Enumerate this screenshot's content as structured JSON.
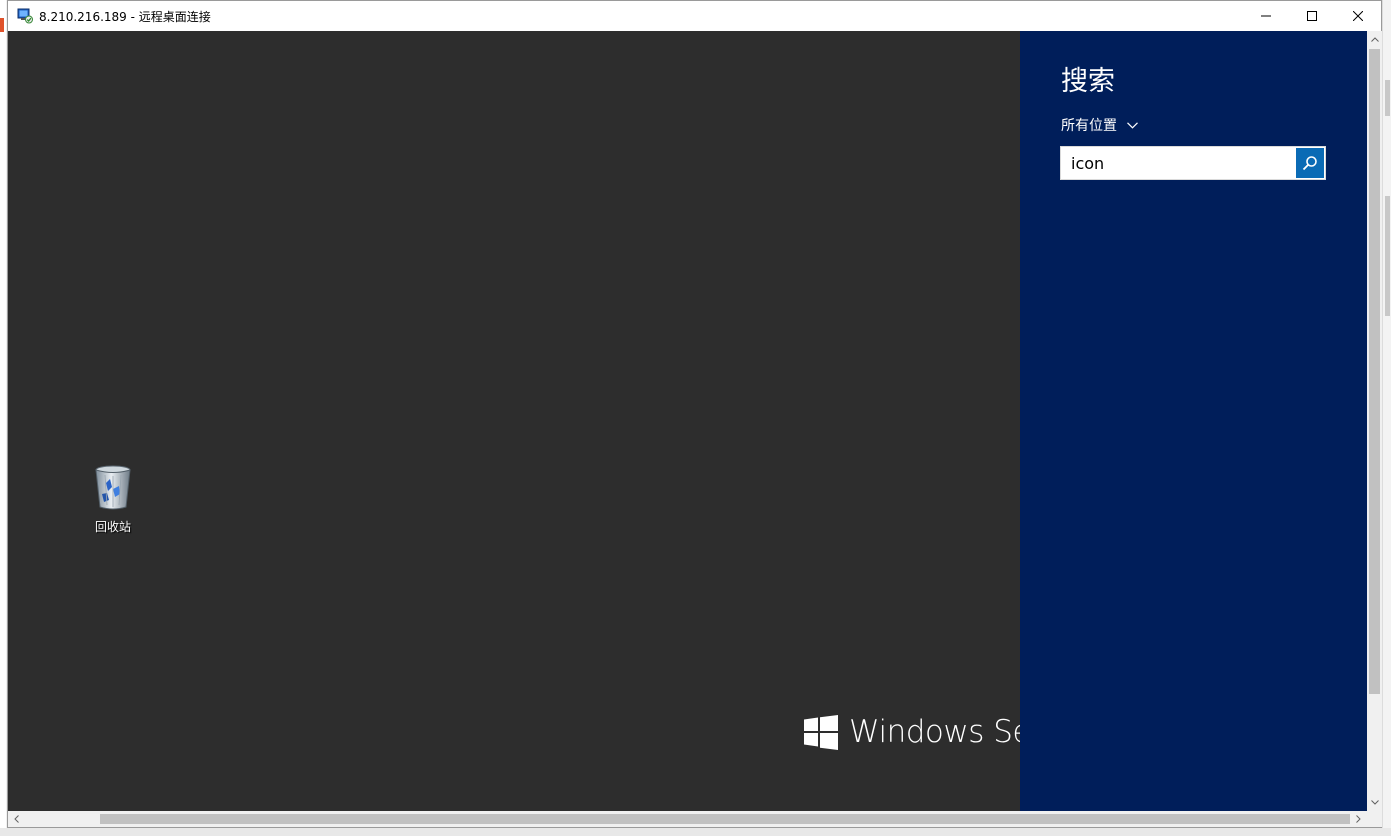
{
  "window": {
    "title": "8.210.216.189 - 远程桌面连接",
    "icon": "remote-desktop-icon",
    "controls": {
      "minimize": "minimize-icon",
      "maximize": "maximize-icon",
      "close": "close-icon"
    }
  },
  "desktop": {
    "background": "#2d2d2d",
    "icons": [
      {
        "label": "回收站",
        "icon": "recycle-bin-icon"
      }
    ],
    "brand": {
      "logo": "windows-logo-icon",
      "text": "Windows Serv"
    }
  },
  "search_charm": {
    "background": "#001e5a",
    "title": "搜索",
    "scope_label": "所有位置",
    "query": "icon",
    "button_color": "#0a6bb5"
  }
}
